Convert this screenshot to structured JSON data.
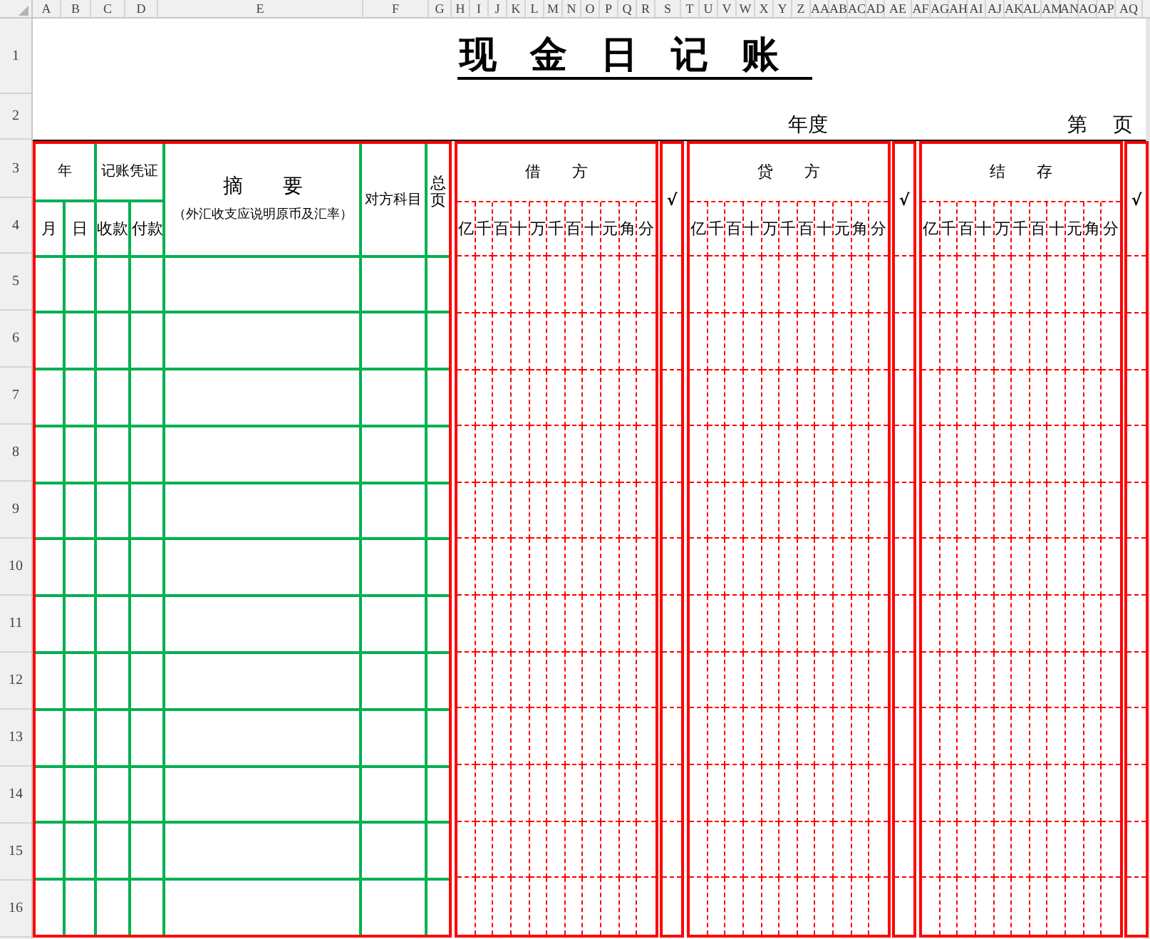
{
  "column_headers": [
    "A",
    "B",
    "C",
    "D",
    "E",
    "F",
    "G",
    "H",
    "I",
    "J",
    "K",
    "L",
    "M",
    "N",
    "O",
    "P",
    "Q",
    "R",
    "S",
    "T",
    "U",
    "V",
    "W",
    "X",
    "Y",
    "Z",
    "AA",
    "AB",
    "AC",
    "AD",
    "AE",
    "AF",
    "AG",
    "AH",
    "AI",
    "AJ",
    "AK",
    "AL",
    "AM",
    "AN",
    "AO",
    "AP",
    "AQ"
  ],
  "row_headers": [
    "1",
    "2",
    "3",
    "4",
    "5",
    "6",
    "7",
    "8",
    "9",
    "10",
    "11",
    "12",
    "13",
    "14",
    "15",
    "16"
  ],
  "title": "现金日记账",
  "year_label": "年度",
  "page_label": {
    "prefix": "第",
    "suffix": "页"
  },
  "ledger": {
    "date": {
      "label": "年",
      "sub": [
        "月",
        "日"
      ]
    },
    "voucher": {
      "label": "记账凭证",
      "sub": [
        "收款",
        "付款"
      ]
    },
    "summary": {
      "label": "摘要",
      "note": "（外汇收支应说明原币及汇率）"
    },
    "counter_account": "对方科目",
    "ledger_page": "总页",
    "amount_sections": [
      {
        "label": "借方",
        "digits": [
          "亿",
          "千",
          "百",
          "十",
          "万",
          "千",
          "百",
          "十",
          "元",
          "角",
          "分"
        ],
        "check": "√"
      },
      {
        "label": "贷方",
        "digits": [
          "亿",
          "千",
          "百",
          "十",
          "万",
          "千",
          "百",
          "十",
          "元",
          "角",
          "分"
        ],
        "check": "√"
      },
      {
        "label": "结存",
        "digits": [
          "亿",
          "千",
          "百",
          "十",
          "万",
          "千",
          "百",
          "十",
          "元",
          "角",
          "分"
        ],
        "check": "√"
      }
    ]
  }
}
